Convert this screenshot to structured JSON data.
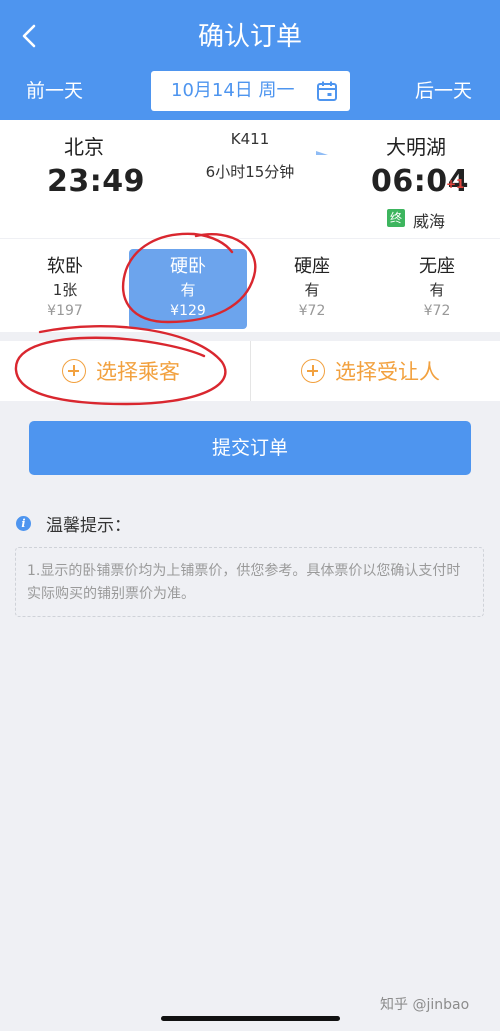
{
  "header": {
    "title": "确认订单",
    "prev_day": "前一天",
    "next_day": "后一天",
    "date": "10月14日 周一"
  },
  "train": {
    "from_station": "北京",
    "departure_time": "23:49",
    "to_station": "大明湖",
    "arrival_time": "06:04",
    "arrival_day_offset": "+1",
    "train_number": "K411",
    "duration": "6小时15分钟",
    "terminal_badge": "终",
    "terminal_station": "威海"
  },
  "seats": [
    {
      "name": "软卧",
      "availability": "1张",
      "price": "¥197"
    },
    {
      "name": "硬卧",
      "availability": "有",
      "price": "¥129"
    },
    {
      "name": "硬座",
      "availability": "有",
      "price": "¥72"
    },
    {
      "name": "无座",
      "availability": "有",
      "price": "¥72"
    }
  ],
  "selected_seat": "硬卧",
  "actions": {
    "select_passenger": "选择乘客",
    "select_beneficiary": "选择受让人",
    "submit": "提交订单"
  },
  "tips": {
    "title": "温馨提示：",
    "text": "1.显示的卧铺票价均为上铺票价，供您参考。具体票价以您确认支付时实际购买的铺别票价为准。"
  },
  "watermark": "知乎 @jinbao",
  "colors": {
    "primary": "#4e95ef",
    "selected_seat_bg": "#6ca4ed",
    "accent_orange": "#f2a13f",
    "annotation_red": "#d9272f",
    "terminal_green": "#3db55e"
  }
}
